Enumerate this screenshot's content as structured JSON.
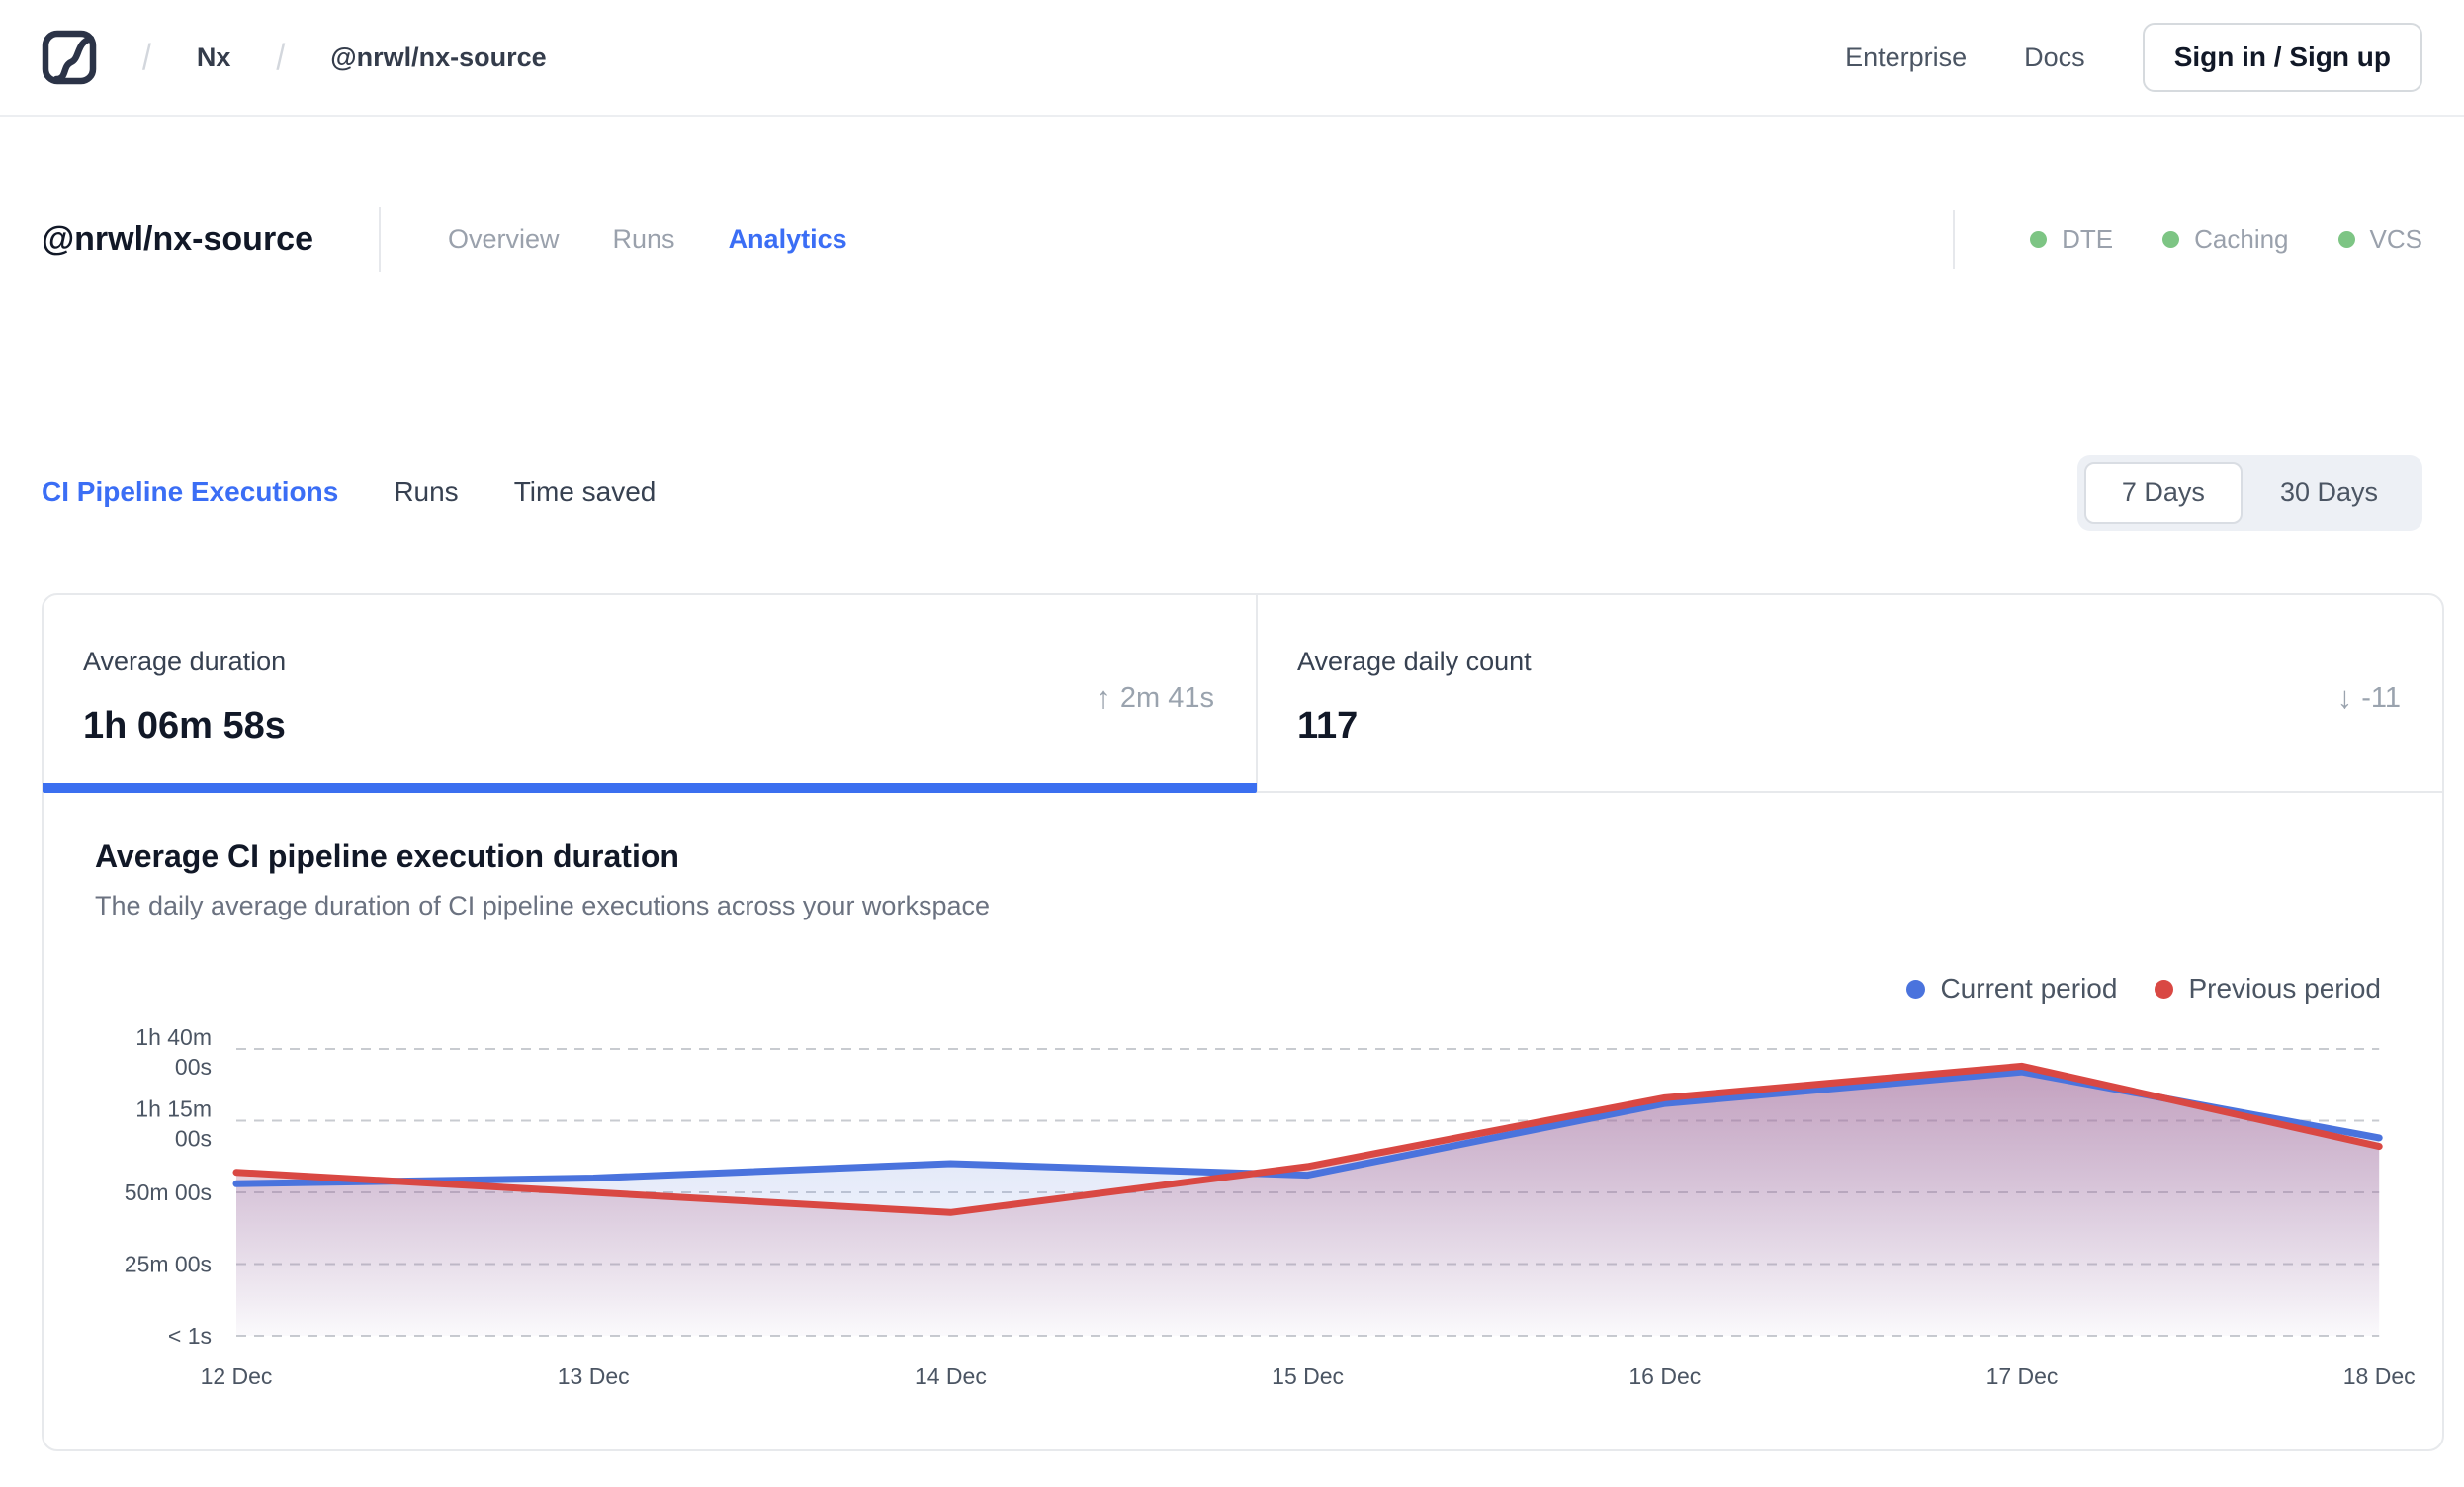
{
  "topbar": {
    "breadcrumb": {
      "separator": "/",
      "org": "Nx",
      "repo": "@nrwl/nx-source"
    },
    "links": {
      "enterprise": "Enterprise",
      "docs": "Docs"
    },
    "signin_label": "Sign in / Sign up"
  },
  "workspace_header": {
    "title": "@nrwl/nx-source",
    "tabs": [
      {
        "label": "Overview",
        "active": false
      },
      {
        "label": "Runs",
        "active": false
      },
      {
        "label": "Analytics",
        "active": true
      }
    ],
    "status_badges": [
      {
        "label": "DTE",
        "color": "#7dc584"
      },
      {
        "label": "Caching",
        "color": "#7dc584"
      },
      {
        "label": "VCS",
        "color": "#7dc584"
      }
    ]
  },
  "analytics_tabs": [
    {
      "label": "CI Pipeline Executions",
      "active": true
    },
    {
      "label": "Runs",
      "active": false
    },
    {
      "label": "Time saved",
      "active": false
    }
  ],
  "range_toggle": {
    "options": [
      {
        "label": "7 Days",
        "selected": true
      },
      {
        "label": "30 Days",
        "selected": false
      }
    ]
  },
  "stat_cards": [
    {
      "label": "Average duration",
      "value": "1h 06m 58s",
      "delta": "2m 41s",
      "delta_direction": "up",
      "active": true
    },
    {
      "label": "Average daily count",
      "value": "117",
      "delta": "-11",
      "delta_direction": "down",
      "active": false
    }
  ],
  "chart_data": {
    "type": "area",
    "title": "Average CI pipeline execution duration",
    "subtitle": "The daily average duration of CI pipeline executions across your workspace",
    "categories": [
      "12 Dec",
      "13 Dec",
      "14 Dec",
      "15 Dec",
      "16 Dec",
      "17 Dec",
      "18 Dec"
    ],
    "series": [
      {
        "name": "Current period",
        "color": "#4a73dd",
        "values_minutes": [
          53,
          55,
          60,
          56,
          81,
          92,
          69
        ]
      },
      {
        "name": "Previous period",
        "color": "#d94843",
        "values_minutes": [
          57,
          50,
          43,
          59,
          83,
          94,
          66
        ]
      }
    ],
    "y_ticks": [
      {
        "minutes": 100,
        "lines": [
          "1h 40m",
          "00s"
        ]
      },
      {
        "minutes": 75,
        "lines": [
          "1h 15m",
          "00s"
        ]
      },
      {
        "minutes": 50,
        "lines": [
          "50m 00s"
        ]
      },
      {
        "minutes": 25,
        "lines": [
          "25m 00s"
        ]
      },
      {
        "minutes": 0,
        "lines": [
          "< 1s"
        ]
      }
    ],
    "ylim_minutes": [
      0,
      100
    ],
    "grid": "dashed-horizontal",
    "legend_position": "top-right",
    "colors": {
      "grid": "#c8cbd0",
      "axis_text": "#4b5563"
    }
  }
}
